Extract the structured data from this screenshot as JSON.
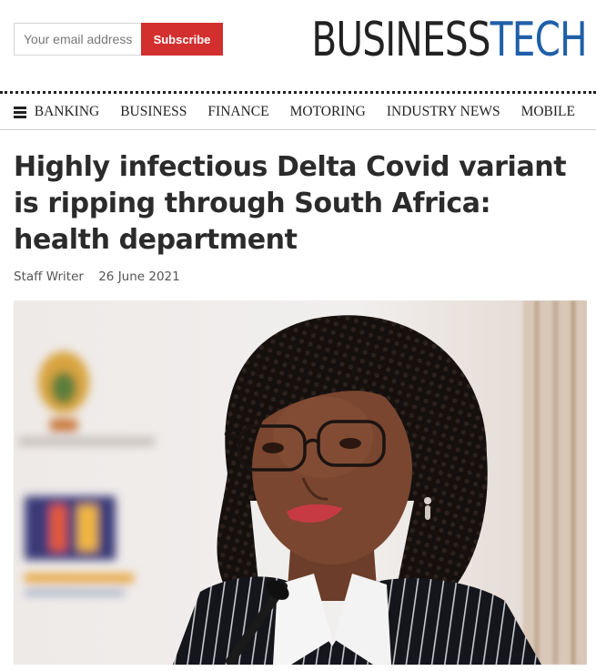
{
  "header": {
    "email_placeholder": "Your email address",
    "subscribe_label": "Subscribe",
    "logo_part1": "BUSINESS",
    "logo_part2": "TECH"
  },
  "nav": {
    "items": [
      "BANKING",
      "BUSINESS",
      "FINANCE",
      "MOTORING",
      "INDUSTRY NEWS",
      "MOBILE"
    ]
  },
  "article": {
    "headline": "Highly infectious Delta Covid variant is ripping through South Africa: health department",
    "author": "Staff Writer",
    "date": "26 June 2021"
  },
  "colors": {
    "subscribe_bg": "#d32f2f",
    "logo_dark": "#222222",
    "logo_blue": "#1f5fa8"
  }
}
